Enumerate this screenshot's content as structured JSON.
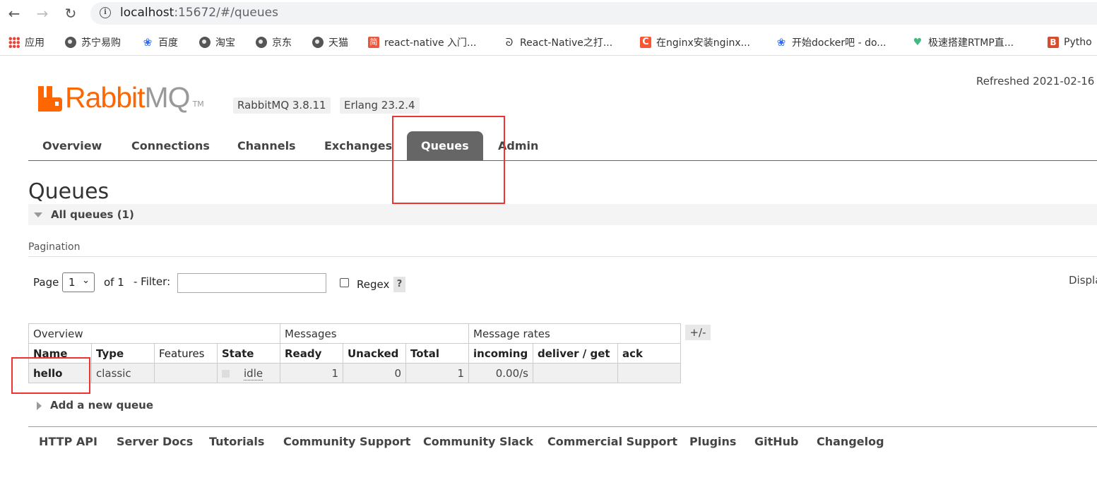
{
  "browser": {
    "url_host": "localhost",
    "url_rest": ":15672/#/queues",
    "bookmarks": [
      {
        "label": "应用",
        "icon": "apps-grid-icon"
      },
      {
        "label": "苏宁易购",
        "icon": "globe-icon"
      },
      {
        "label": "百度",
        "icon": "baidu-paw-icon"
      },
      {
        "label": "淘宝",
        "icon": "globe-icon"
      },
      {
        "label": "京东",
        "icon": "globe-icon"
      },
      {
        "label": "天猫",
        "icon": "globe-icon"
      },
      {
        "label": "react-native 入门...",
        "icon": "jianshu-icon",
        "icon_text": "简"
      },
      {
        "label": "React-Native之打...",
        "icon": "v-logo-icon"
      },
      {
        "label": "在nginx安装nginx...",
        "icon": "csdn-icon",
        "icon_text": "C"
      },
      {
        "label": "开始docker吧 - do...",
        "icon": "baidu-paw-icon"
      },
      {
        "label": "极速搭建RTMP直...",
        "icon": "leaf-icon"
      },
      {
        "label": "Pytho",
        "icon": "b-logo-icon",
        "icon_text": "B"
      }
    ]
  },
  "header": {
    "logo_rabbit": "Rabbit",
    "logo_mq": "MQ",
    "logo_tm": "TM",
    "rabbit_version": "RabbitMQ 3.8.11",
    "erlang_version": "Erlang 23.2.4",
    "refreshed": "Refreshed 2021-02-16"
  },
  "tabs": [
    "Overview",
    "Connections",
    "Channels",
    "Exchanges",
    "Queues",
    "Admin"
  ],
  "active_tab": "Queues",
  "page": {
    "title": "Queues",
    "section_title": "All queues (1)",
    "pagination_label": "Pagination",
    "page_label": "Page",
    "page_value": "1",
    "of_label": "of 1",
    "filter_label": "- Filter:",
    "filter_value": "",
    "regex_label": "Regex",
    "help_label": "?",
    "display_label": "Displa"
  },
  "table": {
    "group_headers": [
      "Overview",
      "Messages",
      "Message rates"
    ],
    "columns": [
      "Name",
      "Type",
      "Features",
      "State",
      "Ready",
      "Unacked",
      "Total",
      "incoming",
      "deliver / get",
      "ack"
    ],
    "plus_minus": "+/-",
    "rows": [
      {
        "name": "hello",
        "type": "classic",
        "features": "",
        "state": "idle",
        "ready": "1",
        "unacked": "0",
        "total": "1",
        "incoming": "0.00/s",
        "deliver_get": "",
        "ack": ""
      }
    ]
  },
  "add_queue_label": "Add a new queue",
  "footer": [
    "HTTP API",
    "Server Docs",
    "Tutorials",
    "Community Support",
    "Community Slack",
    "Commercial Support",
    "Plugins",
    "GitHub",
    "Changelog"
  ],
  "colors": {
    "brand": "#ff6600",
    "highlight_box": "#e33333",
    "active_tab": "#666666"
  }
}
